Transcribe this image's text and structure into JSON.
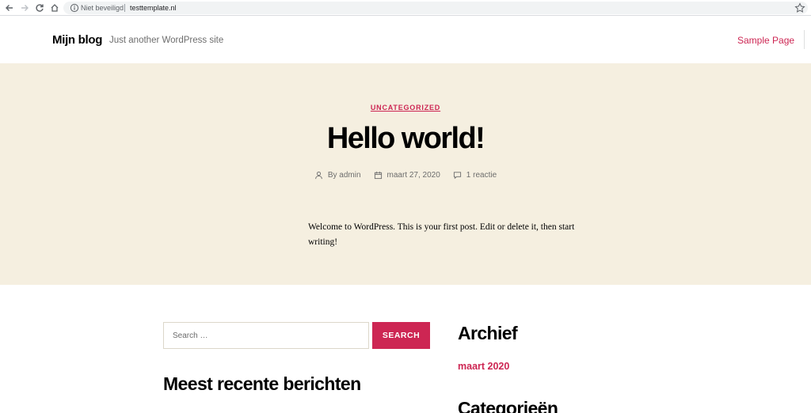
{
  "browser": {
    "security_label": "Niet beveiligd",
    "url": "testtemplate.nl"
  },
  "header": {
    "site_title": "Mijn blog",
    "tagline": "Just another WordPress site",
    "nav_items": [
      "Sample Page"
    ]
  },
  "post": {
    "category": "UNCATEGORIZED",
    "title": "Hello world!",
    "author": "By admin",
    "date": "maart 27, 2020",
    "comments": "1 reactie",
    "content": "Welcome to WordPress. This is your first post. Edit or delete it, then start writing!"
  },
  "widgets": {
    "search": {
      "placeholder": "Search …",
      "button_label": "SEARCH"
    },
    "recent_posts_heading": "Meest recente berichten",
    "archive_heading": "Archief",
    "archive_items": [
      "maart 2020"
    ],
    "categories_heading": "Categorieën"
  },
  "colors": {
    "accent": "#cd2653",
    "hero_background": "#f5efe0",
    "text_secondary": "#6d6d6d"
  },
  "icons": [
    "arrow-left-icon",
    "arrow-right-icon",
    "reload-icon",
    "home-icon",
    "info-icon",
    "star-icon",
    "user-icon",
    "calendar-icon",
    "comment-icon"
  ]
}
